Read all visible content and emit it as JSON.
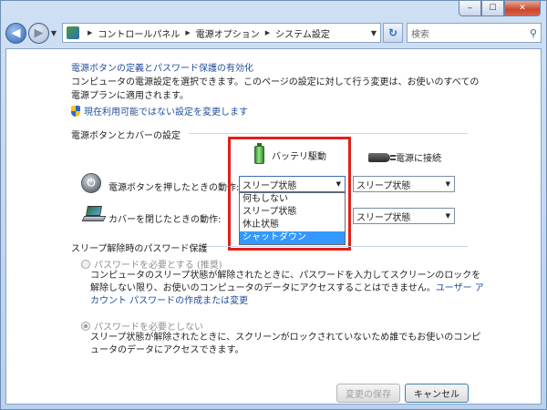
{
  "window": {
    "caption_minimize": "‒",
    "caption_maximize": "☐",
    "caption_close": "✕"
  },
  "navigation": {
    "breadcrumbs": [
      "コントロールパネル",
      "電源オプション",
      "システム設定"
    ],
    "search_placeholder": "検索"
  },
  "page": {
    "title": "電源ボタンの定義とパスワード保護の有効化",
    "description": "コンピュータの電源設定を選択できます。このページの設定に対して行う変更は、お使いのすべての電源プランに適用されます。",
    "admin_link": "現在利用可能ではない設定を変更します"
  },
  "power_section": {
    "heading": "電源ボタンとカバーの設定",
    "battery_label": "バッテリ駆動",
    "plugged_label": "電源に接続",
    "power_button_label": "電源ボタンを押したときの動作:",
    "lid_label": "カバーを閉じたときの動作:",
    "power_battery_value": "スリープ状態",
    "power_plugged_value": "スリープ状態",
    "lid_plugged_value": "スリープ状態",
    "dropdown_options": [
      "何もしない",
      "スリープ状態",
      "休止状態",
      "シャットダウン"
    ],
    "dropdown_highlighted": "シャットダウン"
  },
  "password_section": {
    "heading": "スリープ解除時のパスワード保護",
    "require_label": "パスワードを必要とする (推奨)",
    "require_desc_1": "コンピュータのスリープ状態が解除されたときに、パスワードを入力してスクリーンのロックを",
    "require_desc_2": "解除しない限り、お使いのコンピュータのデータにアクセスすることはできません。",
    "require_link_1": "ユーザー ア",
    "require_link_2": "カウント パスワードの作成または変更",
    "no_require_label": "パスワードを必要としない",
    "no_require_desc_1": "スリープ状態が解除されたときに、スクリーンがロックされていないため誰でもお使いのコンピ",
    "no_require_desc_2": "ュータのデータにアクセスできます。",
    "selected_option": "パスワードを必要としない"
  },
  "buttons": {
    "save": "変更の保存",
    "cancel": "キャンセル"
  },
  "colors": {
    "link": "#1f4e9c",
    "highlight": "#3399ff",
    "annotation_box": "#e0201a"
  }
}
